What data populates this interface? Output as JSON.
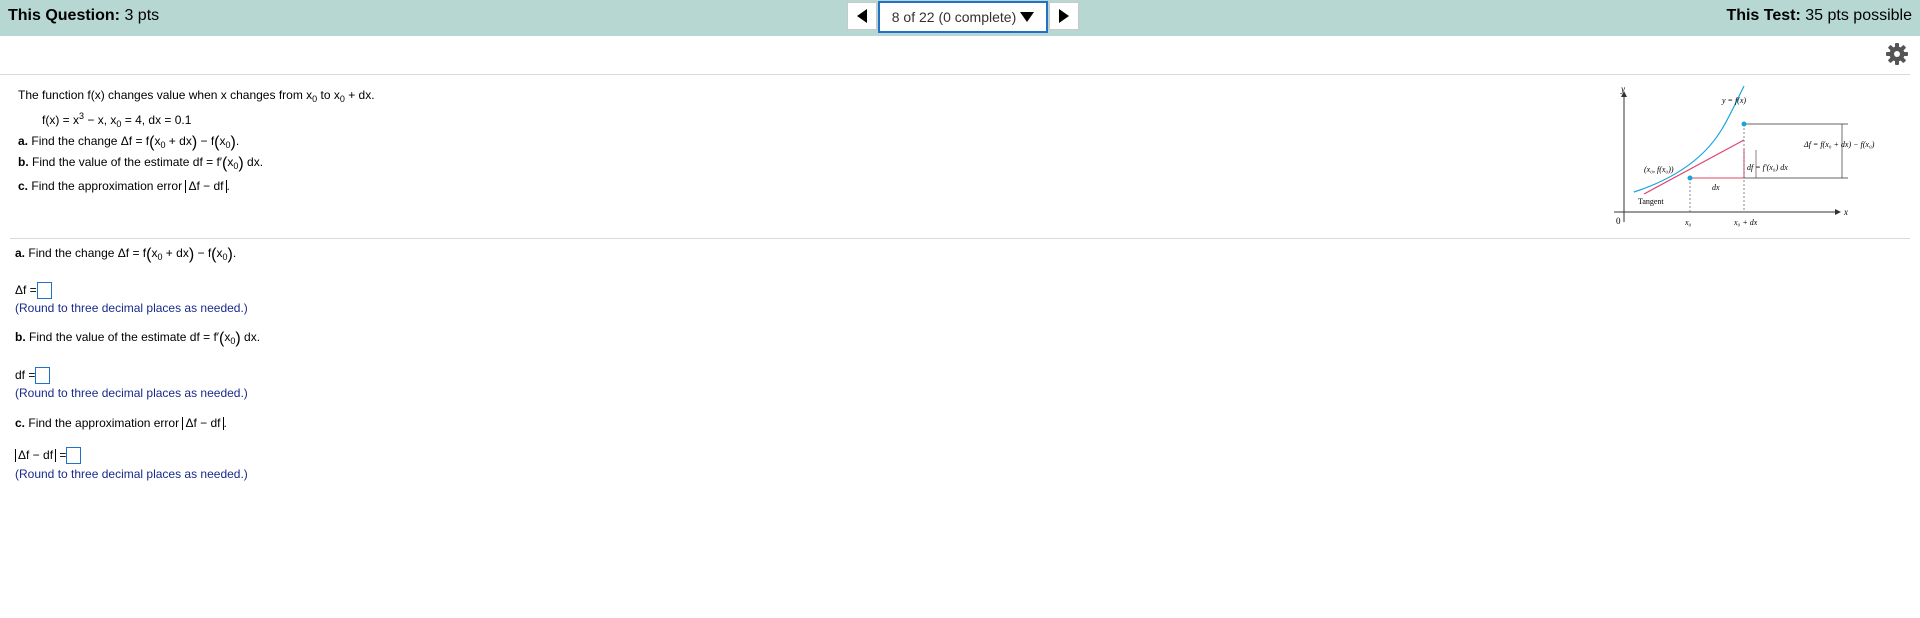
{
  "header": {
    "question_label": "This Question:",
    "question_value": "3 pts",
    "test_label": "This Test:",
    "test_value": "35 pts possible",
    "question_selector": "8 of 22 (0 complete)"
  },
  "problem": {
    "intro": "The function f(x) changes value when x changes from x",
    "intro_sub": "0",
    "intro_mid": " to x",
    "intro_sub2": "0",
    "intro_end": " + dx.",
    "given_f": "f(x) = x",
    "given_exp": "3",
    "given_rest": " − x, x",
    "given_sub": "0",
    "given_vals": " = 4, dx = 0.1",
    "part_a_label": "a.",
    "part_a": "Find the change Δf = f",
    "part_b_label": "b.",
    "part_b": "Find the value of the estimate df = f′",
    "part_c_label": "c.",
    "part_c": "Find the approximation error",
    "abs_expr": "Δf − df"
  },
  "figure": {
    "y_axis": "y",
    "x_axis": "x",
    "curve_label": "y = f(x)",
    "delta_f_label": "Δf = f(x₀ + dx) − f(x₀)",
    "df_label": "df = f′(x₀) dx",
    "point_label": "(x₀, f(x₀))",
    "dx_label": "dx",
    "tangent_label": "Tangent",
    "origin_label": "0",
    "x0_label": "x₀",
    "x0dx_label": "x₀ + dx"
  },
  "answers": {
    "delta_f_lhs": "Δf =",
    "df_lhs": "df =",
    "abs_eq": "=",
    "hint": "(Round to three decimal places as needed.)"
  },
  "colors": {
    "header_bg": "#b7d7d3",
    "selector_border": "#1f72c8",
    "hint_text": "#1a2a8c",
    "curve": "#1aa3e0",
    "tangent": "#e0446b"
  }
}
